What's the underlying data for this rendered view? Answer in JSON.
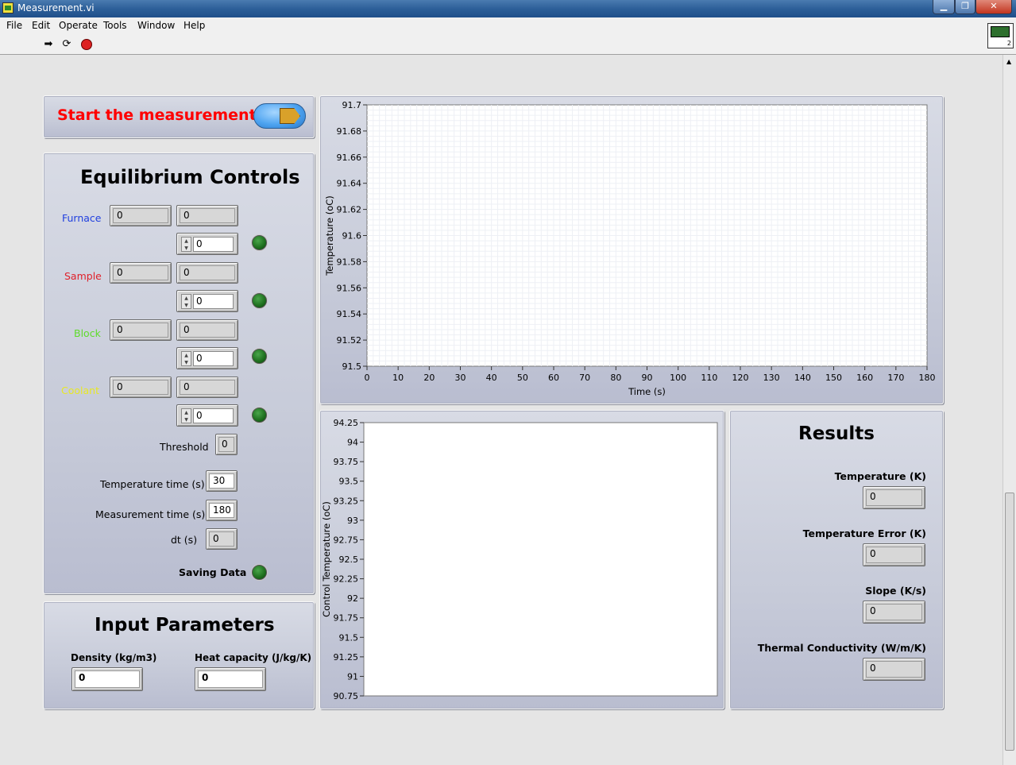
{
  "window": {
    "title": "Measurement.vi"
  },
  "menu": [
    "File",
    "Edit",
    "Operate",
    "Tools",
    "Window",
    "Help"
  ],
  "vi_icon_badge": "2",
  "start": {
    "label": "Start the measurement"
  },
  "equilibrium": {
    "title": "Equilibrium Controls",
    "rows": [
      {
        "label": "Furnace",
        "color": "#1f3fdf",
        "a": "0",
        "b": "0",
        "ctl": "0"
      },
      {
        "label": "Sample",
        "color": "#e0202a",
        "a": "0",
        "b": "0",
        "ctl": "0"
      },
      {
        "label": "Block",
        "color": "#5edc2a",
        "a": "0",
        "b": "0",
        "ctl": "0"
      },
      {
        "label": "Coolant",
        "color": "#e8e824",
        "a": "0",
        "b": "0",
        "ctl": "0"
      }
    ],
    "threshold_label": "Threshold",
    "threshold": "0",
    "temp_time_label": "Temperature time (s)",
    "temp_time": "30",
    "meas_time_label": "Measurement time (s)",
    "meas_time": "180",
    "dt_label": "dt (s)",
    "dt": "0",
    "saving_label": "Saving Data"
  },
  "input": {
    "title": "Input Parameters",
    "density_label": "Density (kg/m3)",
    "density": "0",
    "heat_label": "Heat capacity (J/kg/K)",
    "heat": "0"
  },
  "results": {
    "title": "Results",
    "items": [
      {
        "label": "Temperature (K)",
        "value": "0"
      },
      {
        "label": "Temperature Error (K)",
        "value": "0"
      },
      {
        "label": "Slope (K/s)",
        "value": "0"
      },
      {
        "label": "Thermal Conductivity (W/m/K)",
        "value": "0"
      }
    ]
  },
  "chart_data": [
    {
      "type": "line",
      "xlabel": "Time (s)",
      "ylabel": "Temperature (oC)",
      "x_ticks": [
        "0",
        "10",
        "20",
        "30",
        "40",
        "50",
        "60",
        "70",
        "80",
        "90",
        "100",
        "110",
        "120",
        "130",
        "140",
        "150",
        "160",
        "170",
        "180"
      ],
      "y_ticks": [
        "91.7",
        "91.68",
        "91.66",
        "91.64",
        "91.62",
        "91.6",
        "91.58",
        "91.56",
        "91.54",
        "91.52",
        "91.5"
      ],
      "xlim": [
        0,
        180
      ],
      "ylim": [
        91.5,
        91.7
      ],
      "grid": true,
      "series": []
    },
    {
      "type": "line",
      "xlabel": "",
      "ylabel": "Control Temperature (oC)",
      "y_ticks": [
        "94.25",
        "94",
        "93.75",
        "93.5",
        "93.25",
        "93",
        "92.75",
        "92.5",
        "92.25",
        "92",
        "91.75",
        "91.5",
        "91.25",
        "91",
        "90.75"
      ],
      "ylim": [
        90.75,
        94.25
      ],
      "grid": false,
      "series": []
    }
  ]
}
